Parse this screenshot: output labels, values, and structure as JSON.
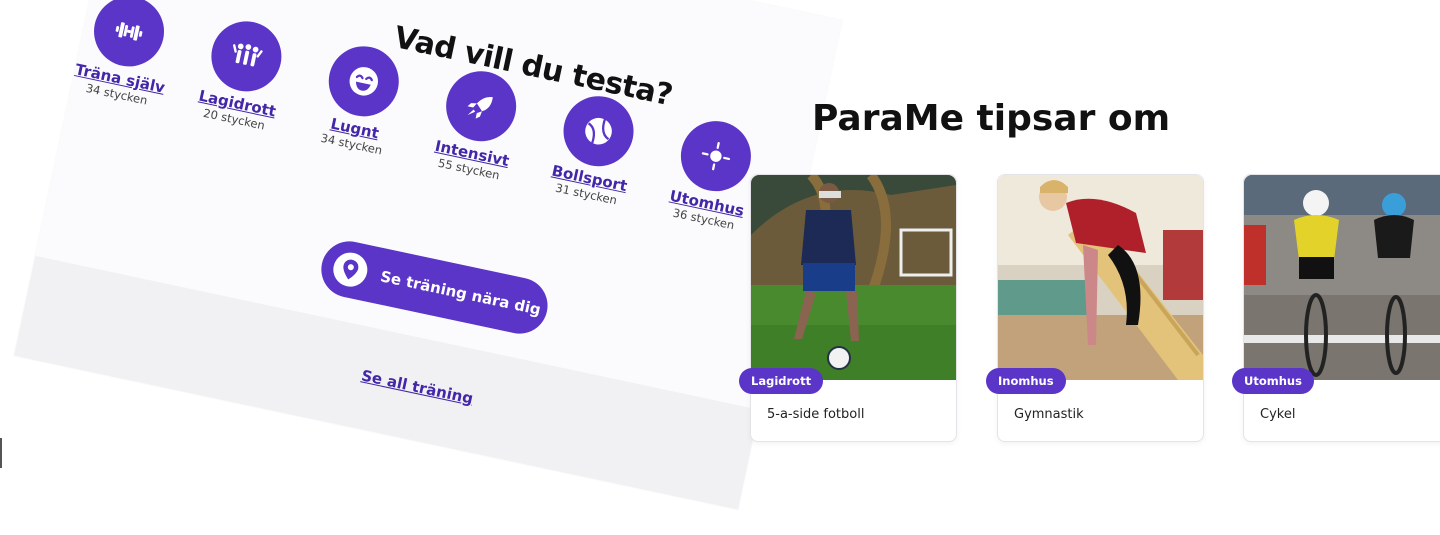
{
  "colors": {
    "accent": "#5a35c8",
    "link": "#4327a8"
  },
  "left_panel": {
    "title": "Vad vill du testa?",
    "categories": [
      {
        "label": "Träna själv",
        "count": "34 stycken",
        "icon": "dumbbell-icon"
      },
      {
        "label": "Lagidrott",
        "count": "20 stycken",
        "icon": "team-people-icon"
      },
      {
        "label": "Lugnt",
        "count": "34 stycken",
        "icon": "smiley-icon"
      },
      {
        "label": "Intensivt",
        "count": "55 stycken",
        "icon": "rocket-icon"
      },
      {
        "label": "Bollsport",
        "count": "31 stycken",
        "icon": "ball-icon"
      },
      {
        "label": "Utomhus",
        "count": "36 stycken",
        "icon": "outdoor-icon"
      }
    ],
    "near_button": {
      "label": "Se träning nära dig",
      "icon": "location-pin-icon"
    },
    "see_all_link": "Se all träning"
  },
  "tips": {
    "title": "ParaMe tipsar om",
    "cards": [
      {
        "tag": "Lagidrott",
        "title": "5-a-side fotboll",
        "photo": "football-photo"
      },
      {
        "tag": "Inomhus",
        "title": "Gymnastik",
        "photo": "gymnastics-photo"
      },
      {
        "tag": "Utomhus",
        "title": "Cykel",
        "photo": "cycling-photo"
      }
    ]
  }
}
